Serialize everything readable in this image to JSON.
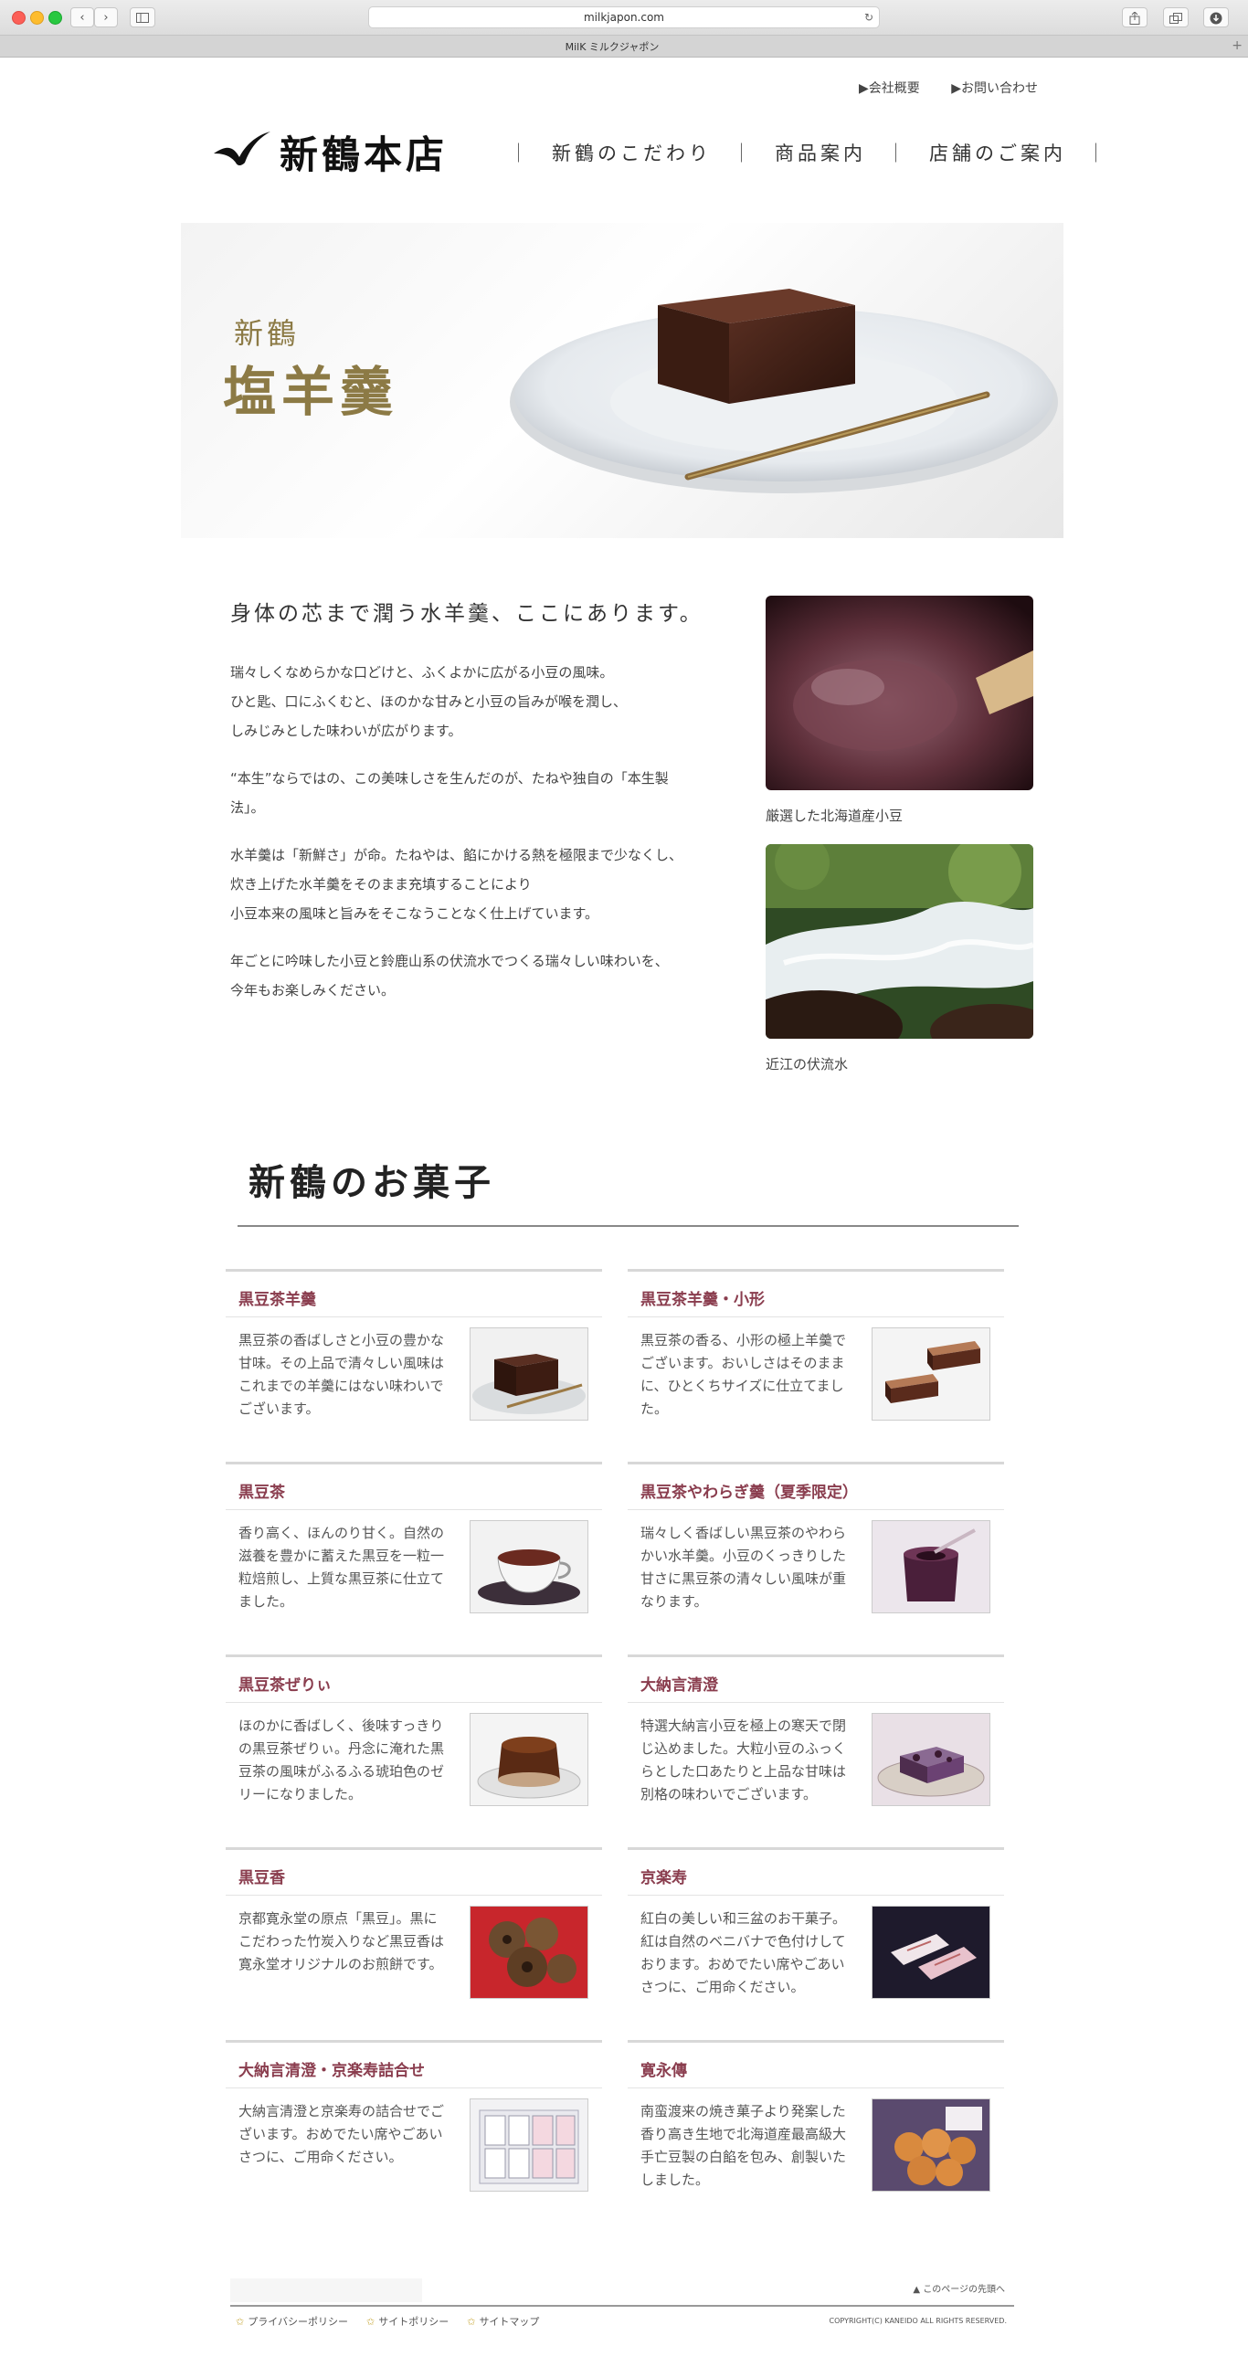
{
  "browser": {
    "url": "milkjapon.com",
    "tab_title": "MilK ミルクジャポン",
    "back": "‹",
    "forward": "›",
    "reload_icon": "↻",
    "new_tab": "+"
  },
  "header": {
    "top_links": [
      "▶会社概要",
      "▶お問い合わせ"
    ],
    "logo_text": "新鶴本店",
    "nav": [
      "新鶴のこだわり",
      "商品案内",
      "店舗のご案内"
    ],
    "nav_separator": "｜"
  },
  "hero": {
    "title_small": "新鶴",
    "title": "塩羊羹"
  },
  "intro": {
    "heading": "身体の芯まで潤う水羊羹、ここにあります。",
    "paragraphs": [
      [
        "瑞々しくなめらかな口どけと、ふくよかに広がる小豆の風味。",
        "ひと匙、口にふくむと、ほのかな甘みと小豆の旨みが喉を潤し、",
        "しみじみとした味わいが広がります。"
      ],
      [
        "“本生”ならではの、この美味しさを生んだのが、たねや独自の「本生製",
        "法」。"
      ],
      [
        "水羊羹は「新鮮さ」が命。たねやは、餡にかける熱を極限まで少なくし、",
        "炊き上げた水羊羹をそのまま充填することにより",
        "小豆本来の風味と旨みをそこなうことなく仕上げています。"
      ],
      [
        "年ごとに吟味した小豆と鈴鹿山系の伏流水でつくる瑞々しい味わいを、",
        "今年もお楽しみください。"
      ]
    ],
    "images": [
      {
        "caption": "厳選した北海道産小豆"
      },
      {
        "caption": "近江の伏流水"
      }
    ]
  },
  "sweets": {
    "title": "新鶴のお菓子",
    "items": [
      {
        "name": "黒豆茶羊羹",
        "desc": [
          "黒豆茶の香ばしさと小豆の豊かな",
          "甘味。その上品で清々しい風味は",
          "これまでの羊羹にはない味わいで",
          "ございます。"
        ]
      },
      {
        "name": "黒豆茶羊羹・小形",
        "desc": [
          "黒豆茶の香る、小形の極上羊羹で",
          "ございます。おいしさはそのまま",
          "に、ひとくちサイズに仕立てまし",
          "た。"
        ]
      },
      {
        "name": "黒豆茶",
        "desc": [
          "香り高く、ほんのり甘く。自然の",
          "滋養を豊かに蓄えた黒豆を一粒一",
          "粒焙煎し、上質な黒豆茶に仕立て",
          "ました。"
        ]
      },
      {
        "name": "黒豆茶やわらぎ羹（夏季限定）",
        "desc": [
          "瑞々しく香ばしい黒豆茶のやわら",
          "かい水羊羹。小豆のくっきりした",
          "甘さに黒豆茶の清々しい風味が重",
          "なります。"
        ]
      },
      {
        "name": "黒豆茶ぜりぃ",
        "desc": [
          "ほのかに香ばしく、後味すっきり",
          "の黒豆茶ぜりぃ。丹念に淹れた黒",
          "豆茶の風味がふるふる琥珀色のゼ",
          "リーになりました。"
        ]
      },
      {
        "name": "大納言清澄",
        "desc": [
          "特選大納言小豆を極上の寒天で閉",
          "じ込めました。大粒小豆のふっく",
          "らとした口あたりと上品な甘味は",
          "別格の味わいでございます。"
        ]
      },
      {
        "name": "黒豆香",
        "desc": [
          "京都寛永堂の原点「黒豆」。黒に",
          "こだわった竹炭入りなど黒豆香は",
          "寛永堂オリジナルのお煎餅です。"
        ]
      },
      {
        "name": "京楽寿",
        "desc": [
          "紅白の美しい和三盆のお干菓子。",
          "紅は自然のベニバナで色付けして",
          "おります。おめでたい席やごあい",
          "さつに、ご用命ください。"
        ]
      },
      {
        "name": "大納言清澄・京楽寿詰合せ",
        "desc": [
          "大納言清澄と京楽寿の詰合せでご",
          "ざいます。おめでたい席やごあい",
          "さつに、ご用命ください。"
        ]
      },
      {
        "name": "寛永傳",
        "desc": [
          "南蛮渡来の焼き菓子より発案した",
          "香り高き生地で北海道産最高級大",
          "手亡豆製の白餡を包み、創製いた",
          "しました。"
        ]
      }
    ]
  },
  "footer": {
    "page_top": "▲ このページの先頭へ",
    "links": [
      "プライバシーポリシー",
      "サイトポリシー",
      "サイトマップ"
    ],
    "star_icon": "✩",
    "copyright": "COPYRIGHT(C) KANEIDO ALL RIGHTS RESERVED."
  }
}
